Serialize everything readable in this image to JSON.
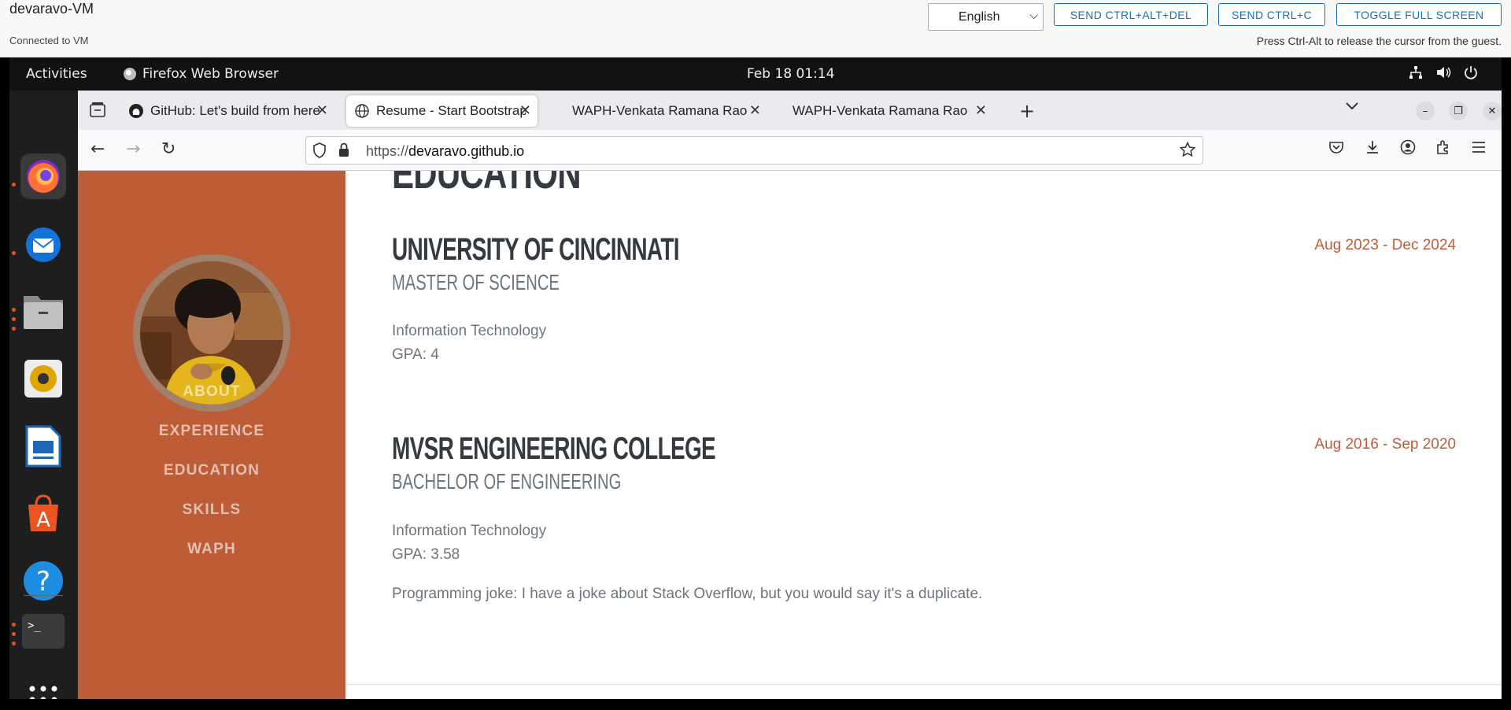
{
  "vm": {
    "title": "devaravo-VM",
    "status": "Connected to VM",
    "language": "English",
    "buttons": {
      "ctrl_alt_del": "SEND CTRL+ALT+DEL",
      "ctrl_c": "SEND CTRL+C",
      "fullscreen": "TOGGLE FULL SCREEN"
    },
    "hint": "Press Ctrl-Alt to release the cursor from the guest."
  },
  "topbar": {
    "activities": "Activities",
    "app_name": "Firefox Web Browser",
    "clock": "Feb 18  01:14"
  },
  "browser": {
    "tabs": [
      {
        "title": "GitHub: Let's build from here"
      },
      {
        "title": "Resume - Start Bootstrap Theme"
      },
      {
        "title": "WAPH-Venkata Ramana Rao"
      },
      {
        "title": "WAPH-Venkata Ramana Rao"
      }
    ],
    "url_prefix": "https://",
    "url_domain": "devaravo.github.io"
  },
  "sidebar": {
    "nav": [
      "ABOUT",
      "EXPERIENCE",
      "EDUCATION",
      "SKILLS",
      "WAPH"
    ]
  },
  "content": {
    "section_title": "EDUCATION",
    "entries": [
      {
        "school": "UNIVERSITY OF CINCINNATI",
        "degree": "MASTER OF SCIENCE",
        "field": "Information Technology",
        "gpa": "GPA: 4",
        "dates": "Aug 2023 - Dec 2024"
      },
      {
        "school": "MVSR ENGINEERING COLLEGE",
        "degree": "BACHELOR OF ENGINEERING",
        "field": "Information Technology",
        "gpa": "GPA: 3.58",
        "dates": "Aug 2016 - Sep 2020"
      }
    ],
    "joke": "Programming joke: I have a joke about Stack Overflow, but you would say it's a duplicate."
  },
  "colors": {
    "accent": "#bd5d38",
    "heading": "#343a40",
    "muted": "#6c757d"
  }
}
